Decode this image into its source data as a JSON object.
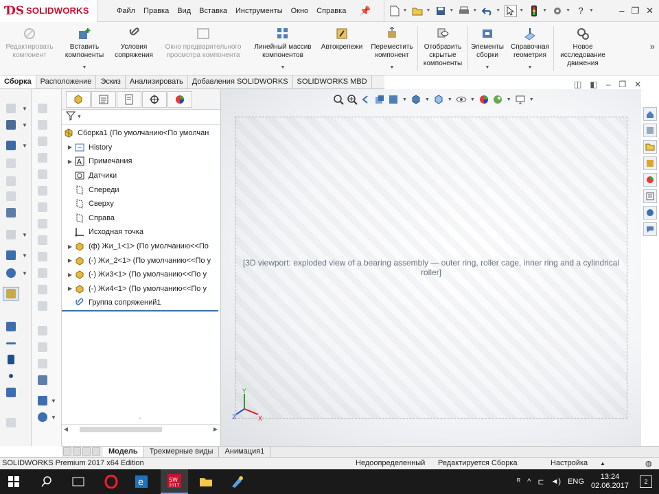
{
  "app": {
    "brand": "SOLIDWORKS",
    "edition": "SOLIDWORKS Premium 2017 x64 Edition"
  },
  "menu": [
    "Файл",
    "Правка",
    "Вид",
    "Вставка",
    "Инструменты",
    "Окно",
    "Справка"
  ],
  "ribbon": [
    {
      "label": "Редактировать компонент",
      "icon": "edit-component-icon",
      "disabled": true,
      "dropdown": false
    },
    {
      "label": "Вставить компоненты",
      "icon": "insert-components-icon",
      "disabled": false,
      "dropdown": true
    },
    {
      "label": "Условия сопряжения",
      "icon": "mate-icon",
      "disabled": false,
      "dropdown": false
    },
    {
      "label": "Окно предварительного просмотра компонента",
      "icon": "component-preview-icon",
      "disabled": true,
      "dropdown": false
    },
    {
      "label": "Линейный массив компонентов",
      "icon": "linear-pattern-icon",
      "disabled": false,
      "dropdown": true
    },
    {
      "label": "Автокрепежи",
      "icon": "smart-fasteners-icon",
      "disabled": false,
      "dropdown": false
    },
    {
      "label": "Переместить компонент",
      "icon": "move-component-icon",
      "disabled": false,
      "dropdown": true
    },
    {
      "label": "Отобразить скрытые компоненты",
      "icon": "show-hidden-icon",
      "disabled": false,
      "dropdown": false
    },
    {
      "label": "Элементы сборки",
      "icon": "assembly-features-icon",
      "disabled": false,
      "dropdown": true
    },
    {
      "label": "Справочная геометрия",
      "icon": "reference-geometry-icon",
      "disabled": false,
      "dropdown": true
    },
    {
      "label": "Новое исследование движения",
      "icon": "motion-study-icon",
      "disabled": false,
      "dropdown": false
    }
  ],
  "tabs": [
    "Сборка",
    "Расположение",
    "Эскиз",
    "Анализировать",
    "Добавления SOLIDWORKS",
    "SOLIDWORKS MBD"
  ],
  "active_tab": "Сборка",
  "tree": [
    {
      "label": "Сборка1  (По умолчанию<По умолчан",
      "icon": "assembly-icon",
      "expander": false,
      "indent": 0
    },
    {
      "label": "History",
      "icon": "history-icon",
      "expander": true,
      "indent": 1
    },
    {
      "label": "Примечания",
      "icon": "annotations-icon",
      "expander": true,
      "indent": 1
    },
    {
      "label": "Датчики",
      "icon": "sensors-icon",
      "expander": false,
      "indent": 1
    },
    {
      "label": "Спереди",
      "icon": "plane-icon",
      "expander": false,
      "indent": 1
    },
    {
      "label": "Сверху",
      "icon": "plane-icon",
      "expander": false,
      "indent": 1
    },
    {
      "label": "Справа",
      "icon": "plane-icon",
      "expander": false,
      "indent": 1
    },
    {
      "label": "Исходная точка",
      "icon": "origin-icon",
      "expander": false,
      "indent": 1
    },
    {
      "label": "(ф) Жи_1<1> (По умолчанию<<По",
      "icon": "part-icon",
      "expander": true,
      "indent": 1
    },
    {
      "label": "(-) Жи_2<1> (По умолчанию<<По у",
      "icon": "part-icon",
      "expander": true,
      "indent": 1
    },
    {
      "label": "(-) Жи3<1> (По умолчанию<<По у",
      "icon": "part-icon",
      "expander": true,
      "indent": 1
    },
    {
      "label": "(-) Жи4<1> (По умолчанию<<По у",
      "icon": "part-icon",
      "expander": true,
      "indent": 1
    },
    {
      "label": "Группа сопряжений1",
      "icon": "mates-group-icon",
      "expander": false,
      "indent": 1
    }
  ],
  "model_tabs": [
    "Модель",
    "Трехмерные виды",
    "Анимация1"
  ],
  "active_model_tab": "Модель",
  "status": {
    "edition": "SOLIDWORKS Premium 2017 x64 Edition",
    "definition": "Недоопределенный",
    "editing": "Редактируется Сборка",
    "settings": "Настройка"
  },
  "viewport": {
    "placeholder": "[3D viewport: exploded view of a bearing assembly — outer ring, roller cage, inner ring and a cylindrical roller]"
  },
  "taskbar": {
    "lang": "ENG",
    "time": "13:24",
    "date": "02.06.2017",
    "notifications": "2"
  },
  "colors": {
    "brand_red": "#c8102e",
    "accent_blue": "#3a6fb0",
    "taskbar": "#1a1a1a"
  }
}
